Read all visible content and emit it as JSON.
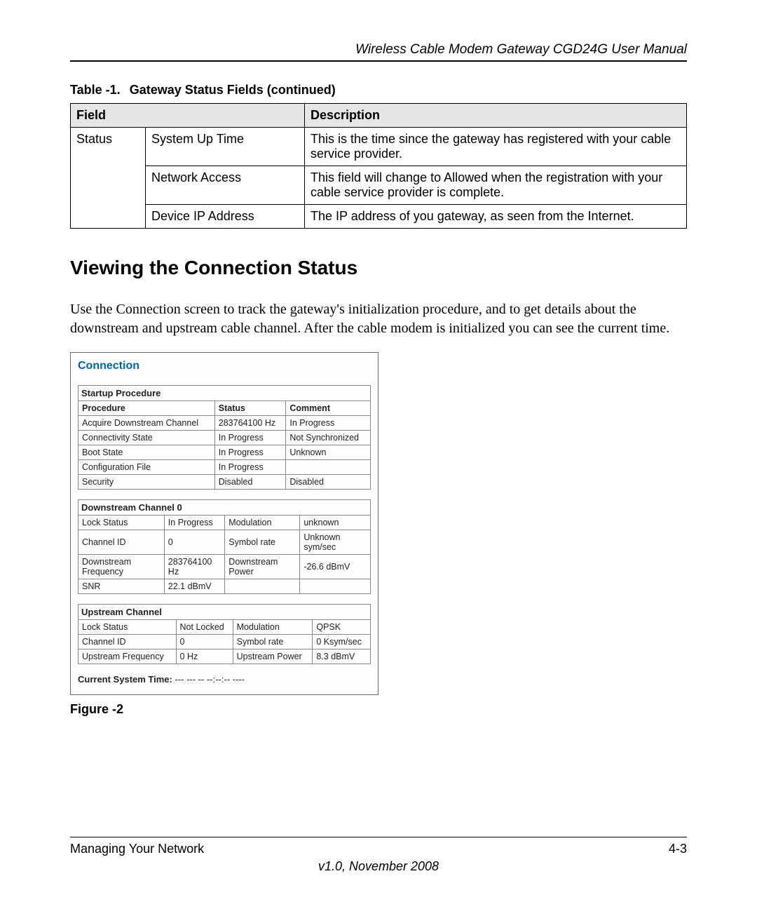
{
  "header": {
    "title": "Wireless Cable Modem Gateway CGD24G User Manual"
  },
  "table1": {
    "label": "Table -1.",
    "title": "Gateway Status Fields (continued)",
    "heads": {
      "field": "Field",
      "desc": "Description"
    },
    "group": "Status",
    "rows": [
      {
        "sub": "System Up Time",
        "desc": "This is the time since the gateway has registered with your cable service provider."
      },
      {
        "sub": "Network Access",
        "desc": "This field will change to Allowed when the registration with your cable service provider is complete."
      },
      {
        "sub": "Device IP Address",
        "desc": "The IP address of you gateway, as seen from the Internet."
      }
    ]
  },
  "section": {
    "heading": "Viewing the Connection Status"
  },
  "paragraph": "Use the Connection screen to track the gateway's initialization procedure, and to get details about the downstream and upstream cable channel. After the cable modem is initialized you can see the current time.",
  "shot": {
    "title": "Connection",
    "startup": {
      "caption": "Startup Procedure",
      "heads": {
        "procedure": "Procedure",
        "status": "Status",
        "comment": "Comment"
      },
      "rows": [
        {
          "p": "Acquire Downstream Channel",
          "s": "283764100 Hz",
          "c": "In Progress"
        },
        {
          "p": "Connectivity State",
          "s": "In Progress",
          "c": "Not Synchronized"
        },
        {
          "p": "Boot State",
          "s": "In Progress",
          "c": "Unknown"
        },
        {
          "p": "Configuration File",
          "s": "In Progress",
          "c": ""
        },
        {
          "p": "Security",
          "s": "Disabled",
          "c": "Disabled"
        }
      ]
    },
    "down": {
      "caption": "Downstream Channel 0",
      "rows": [
        {
          "a": "Lock Status",
          "av": "In Progress",
          "b": "Modulation",
          "bv": "unknown"
        },
        {
          "a": "Channel ID",
          "av": "0",
          "b": "Symbol rate",
          "bv": "Unknown sym/sec"
        },
        {
          "a": "Downstream Frequency",
          "av": "283764100 Hz",
          "b": "Downstream Power",
          "bv": "-26.6 dBmV"
        },
        {
          "a": "SNR",
          "av": "22.1 dBmV",
          "b": "",
          "bv": ""
        }
      ]
    },
    "up": {
      "caption": "Upstream Channel",
      "rows": [
        {
          "a": "Lock Status",
          "av": "Not Locked",
          "b": "Modulation",
          "bv": "QPSK"
        },
        {
          "a": "Channel ID",
          "av": "0",
          "b": "Symbol rate",
          "bv": "0 Ksym/sec"
        },
        {
          "a": "Upstream Frequency",
          "av": "0 Hz",
          "b": "Upstream Power",
          "bv": "8.3 dBmV"
        }
      ]
    },
    "systime": {
      "label": "Current System Time:",
      "value": "--- --- -- --:--:-- ----"
    }
  },
  "figcaption": "Figure -2",
  "footer": {
    "left": "Managing Your Network",
    "right": "4-3",
    "version": "v1.0, November 2008"
  }
}
